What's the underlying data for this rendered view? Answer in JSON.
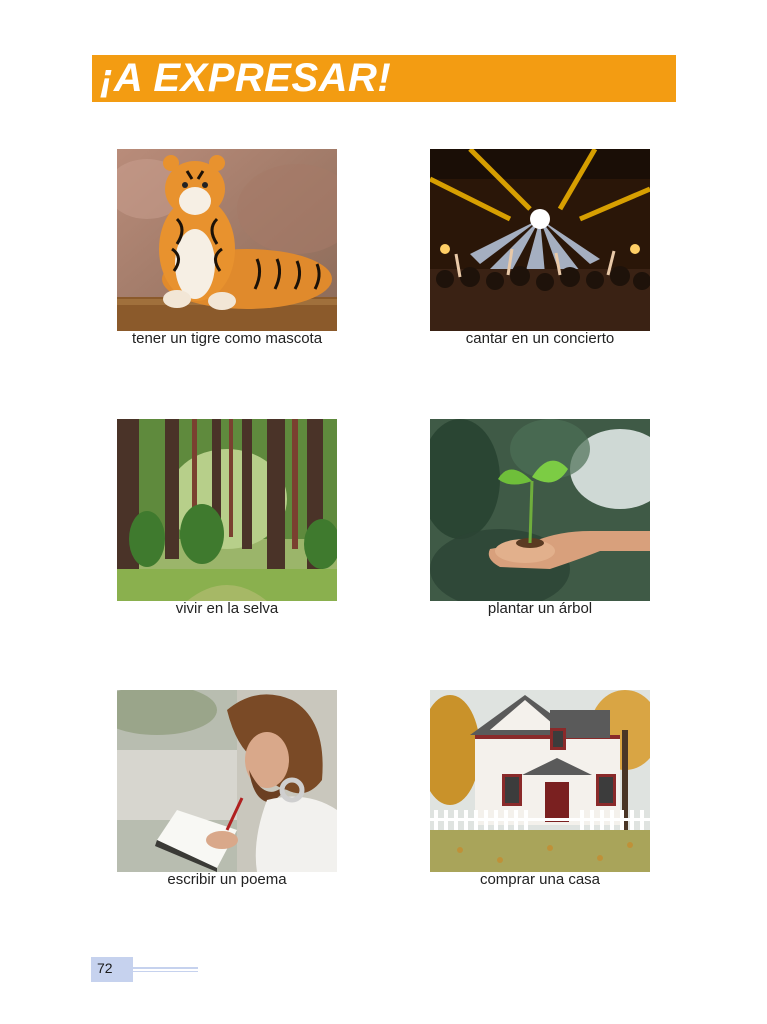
{
  "header": {
    "title": "¡A EXPRESAR!"
  },
  "items": [
    {
      "caption": "tener un tigre como mascota"
    },
    {
      "caption": "cantar en un concierto"
    },
    {
      "caption": "vivir en la selva"
    },
    {
      "caption": "plantar un árbol"
    },
    {
      "caption": "escribir un poema"
    },
    {
      "caption": "comprar una casa"
    }
  ],
  "footer": {
    "page_number": "72"
  },
  "colors": {
    "banner": "#f39c12",
    "page_tab": "#c6d2ee"
  }
}
